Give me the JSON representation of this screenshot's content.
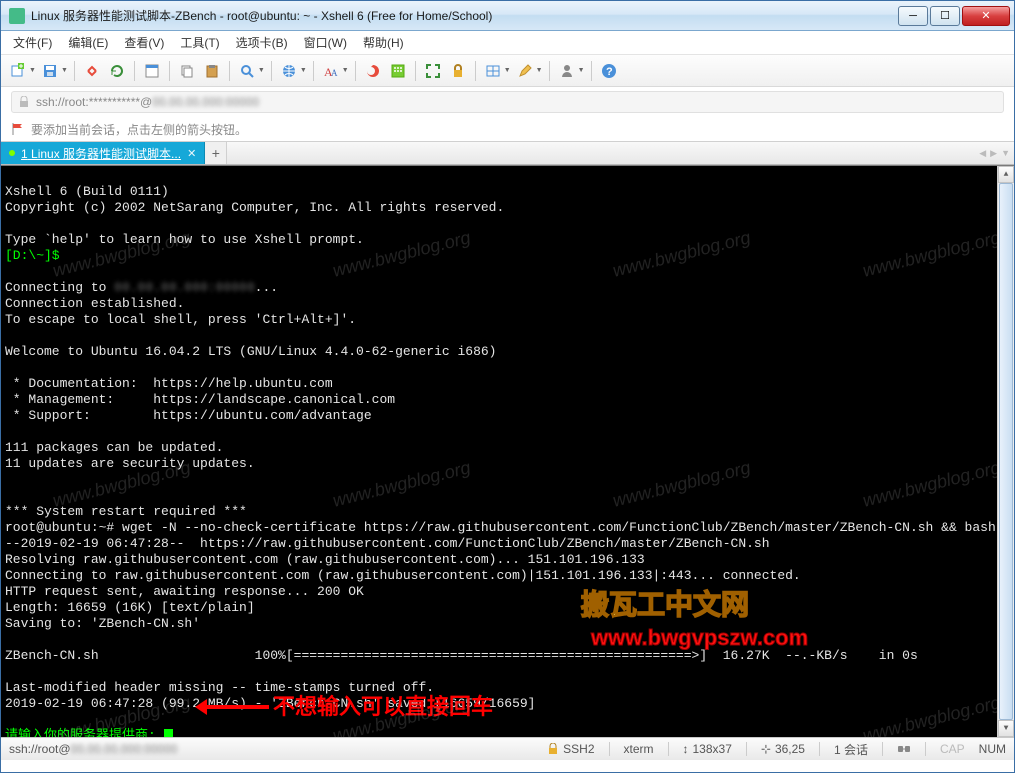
{
  "window": {
    "title": "Linux 服务器性能测试脚本-ZBench - root@ubuntu: ~ - Xshell 6 (Free for Home/School)"
  },
  "menu": {
    "file": "文件(F)",
    "edit": "编辑(E)",
    "view": "查看(V)",
    "tools": "工具(T)",
    "tabs": "选项卡(B)",
    "window": "窗口(W)",
    "help": "帮助(H)"
  },
  "addressbar": {
    "text": "ssh://root:***********@"
  },
  "hint": {
    "text": "要添加当前会话，点击左侧的箭头按钮。"
  },
  "tab": {
    "index": "1",
    "label": "Linux 服务器性能测试脚本..."
  },
  "terminal": {
    "l1": "Xshell 6 (Build 0111)",
    "l2": "Copyright (c) 2002 NetSarang Computer, Inc. All rights reserved.",
    "l3": "Type `help' to learn how to use Xshell prompt.",
    "prompt1": "[D:\\~]$",
    "l4a": "Connecting to ",
    "l5": "Connection established.",
    "l6": "To escape to local shell, press 'Ctrl+Alt+]'.",
    "l7": "Welcome to Ubuntu 16.04.2 LTS (GNU/Linux 4.4.0-62-generic i686)",
    "l8": " * Documentation:  https://help.ubuntu.com",
    "l9": " * Management:     https://landscape.canonical.com",
    "l10": " * Support:        https://ubuntu.com/advantage",
    "l11": "111 packages can be updated.",
    "l12": "11 updates are security updates.",
    "l13": "*** System restart required ***",
    "l14": "root@ubuntu:~# wget -N --no-check-certificate https://raw.githubusercontent.com/FunctionClub/ZBench/master/ZBench-CN.sh && bash ZBench-CN.sh",
    "l15": "--2019-02-19 06:47:28--  https://raw.githubusercontent.com/FunctionClub/ZBench/master/ZBench-CN.sh",
    "l16": "Resolving raw.githubusercontent.com (raw.githubusercontent.com)... 151.101.196.133",
    "l17": "Connecting to raw.githubusercontent.com (raw.githubusercontent.com)|151.101.196.133|:443... connected.",
    "l18": "HTTP request sent, awaiting response... 200 OK",
    "l19": "Length: 16659 (16K) [text/plain]",
    "l20": "Saving to: 'ZBench-CN.sh'",
    "l21a": "ZBench-CN.sh",
    "l21b": "100%[",
    "l21c": "===================================================>",
    "l21d": "]  16.27K  --.-KB/s    in 0s",
    "l22": "Last-modified header missing -- time-stamps turned off.",
    "l23": "2019-02-19 06:47:28 (99.2 MB/s) - 'ZBench-CN.sh' saved [16659/16659]",
    "prompt2": "请输入你的服务器提供商: "
  },
  "annotation": {
    "red_text": "不想输入可以直接回车"
  },
  "watermark": {
    "title": "搬瓦工中文网",
    "url": "www.bwgvpszw.com",
    "diag": "www.bwgblog.org"
  },
  "status": {
    "conn": "ssh://root@",
    "proto": "SSH2",
    "term": "xterm",
    "size": "138x37",
    "pos": "36,25",
    "sessions": "1 会话",
    "cap": "CAP",
    "num": "NUM"
  }
}
